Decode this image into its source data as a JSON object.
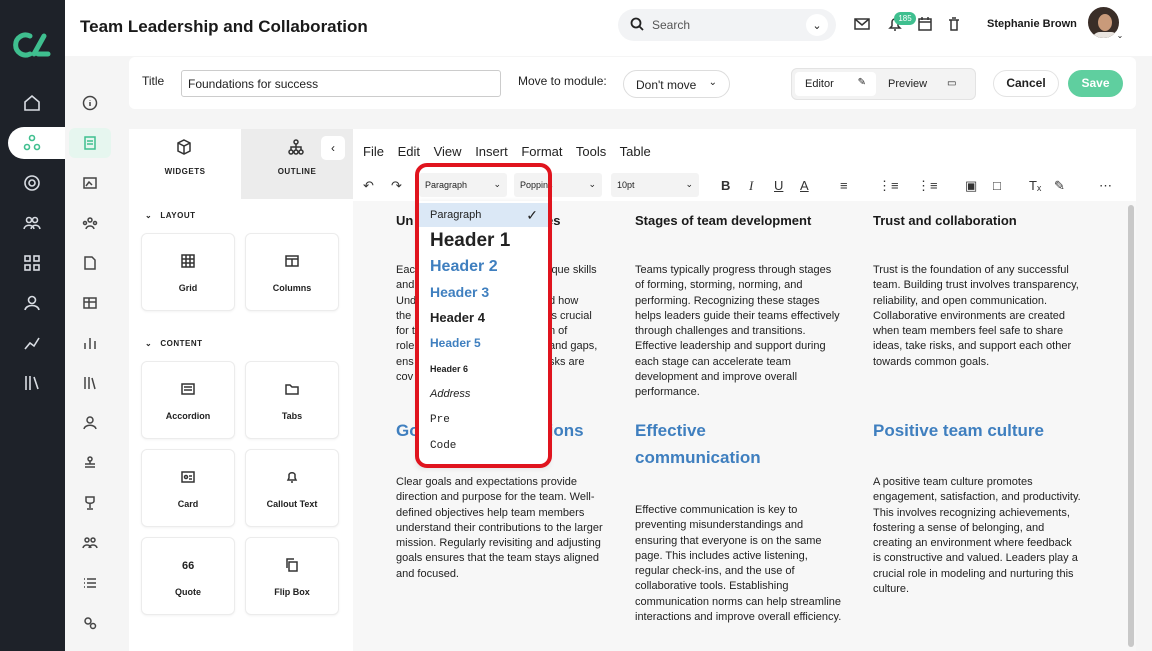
{
  "page": {
    "title": "Team Leadership and Collaboration"
  },
  "topbar": {
    "search_placeholder": "Search",
    "notification_count": "185",
    "user_name": "Stephanie Brown"
  },
  "lesson": {
    "title_label": "Title",
    "title_value": "Foundations for success",
    "move_label": "Move to module:",
    "move_value": "Don't move",
    "editor_label": "Editor",
    "preview_label": "Preview",
    "cancel_label": "Cancel",
    "save_label": "Save"
  },
  "panel": {
    "tabs": [
      "WIDGETS",
      "OUTLINE"
    ],
    "layout_label": "LAYOUT",
    "content_label": "CONTENT",
    "layout_widgets": [
      "Grid",
      "Columns"
    ],
    "content_widgets": [
      "Accordion",
      "Tabs",
      "Card",
      "Callout Text",
      "Quote",
      "Flip Box"
    ],
    "quote_glyph": "66"
  },
  "editor": {
    "menu": [
      "File",
      "Edit",
      "View",
      "Insert",
      "Format",
      "Tools",
      "Table"
    ],
    "block_format": "Paragraph",
    "font": "Poppins",
    "font_size": "10pt",
    "block_formats": [
      "Paragraph",
      "Header 1",
      "Header 2",
      "Header 3",
      "Header 4",
      "Header 5",
      "Header 6",
      "Address",
      "Pre",
      "Code"
    ]
  },
  "document": {
    "col1_heading_left": "Un",
    "col1_heading_right": "es",
    "col1_lines_left": [
      "Eac",
      "and",
      "Und",
      "the",
      "for t",
      "role",
      "ens",
      "cov"
    ],
    "col1_lines_right": [
      "ique skills",
      "",
      "d how",
      "is crucial",
      "n of",
      "and gaps,",
      "sks are",
      ""
    ],
    "col2_heading": "Stages of team development",
    "col2_body": "Teams typically progress through stages of forming, storming, norming, and performing. Recognizing these stages helps leaders guide their teams effectively through challenges and transitions. Effective leadership and support during each stage can accelerate team development and improve overall performance.",
    "col3_heading": "Trust and collaboration",
    "col3_body": "Trust is the foundation of any successful team. Building trust involves transparency, reliability, and open communication. Collaborative environments are created when team members feel safe to share ideas, take risks, and support each other towards common goals.",
    "col1_h2_left": "Go",
    "col1_h2_right": "tions",
    "col1_body2": "Clear goals and expectations provide direction and purpose for the team. Well-defined objectives help team members understand their contributions to the larger mission. Regularly revisiting and adjusting goals ensures that the team stays aligned and focused.",
    "col2_h2": "Effective communication",
    "col2_body2": "Effective communication is key to preventing misunderstandings and ensuring that everyone is on the same page. This includes active listening, regular check-ins, and the use of collaborative tools. Establishing communication norms can help streamline interactions and improve overall efficiency.",
    "col3_h2": "Positive team culture",
    "col3_body2": "A positive team culture promotes engagement, satisfaction, and productivity. This involves recognizing achievements, fostering a sense of belonging, and creating an environment where feedback is constructive and valued. Leaders play a crucial role in modeling and nurturing this culture."
  },
  "colors": {
    "accent": "#3fbf8f",
    "heading_blue": "#3f7fbf",
    "highlight": "#e0141e",
    "sidebar": "#1e2229"
  }
}
